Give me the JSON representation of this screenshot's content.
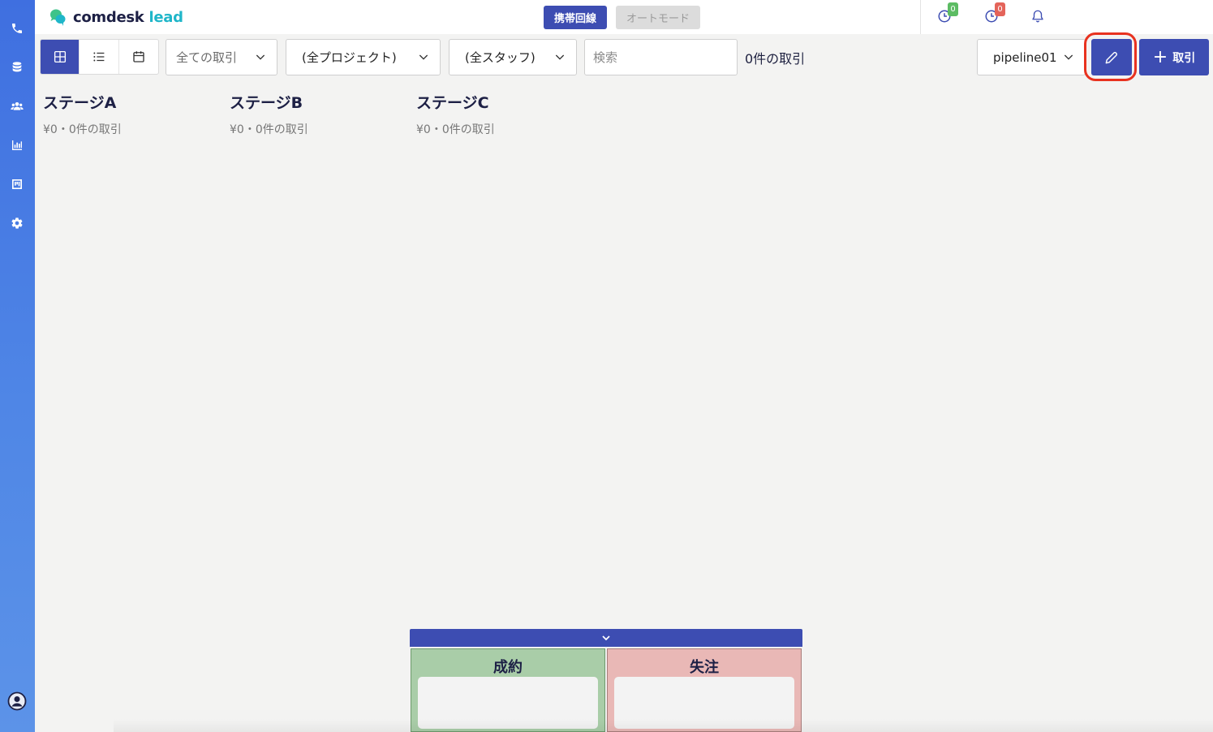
{
  "sidebar": {
    "items": [
      {
        "icon": "phone-icon"
      },
      {
        "icon": "database-icon"
      },
      {
        "icon": "users-icon"
      },
      {
        "icon": "bar-chart-icon"
      },
      {
        "icon": "kanban-icon"
      },
      {
        "icon": "gear-icon"
      }
    ],
    "bottom_icon": "user-circle-icon"
  },
  "header": {
    "logo_comdesk": "comdesk",
    "logo_lead": "lead",
    "mode_line_label": "携帯回線",
    "mode_auto_label": "オートモード",
    "clock1_badge": "0",
    "clock2_badge": "0"
  },
  "toolbar": {
    "deals_filter": "全ての取引",
    "project_filter": "(全プロジェクト)",
    "staff_filter": "(全スタッフ)",
    "search_placeholder": "検索",
    "deal_count": "0件の取引",
    "pipeline": "pipeline01",
    "add_label": "取引"
  },
  "stages": [
    {
      "name": "ステージA",
      "meta": "¥0・0件の取引"
    },
    {
      "name": "ステージB",
      "meta": "¥0・0件の取引"
    },
    {
      "name": "ステージC",
      "meta": "¥0・0件の取引"
    }
  ],
  "dropzones": {
    "won_label": "成約",
    "lost_label": "失注"
  },
  "colors": {
    "accent": "#3d4db2",
    "sidebar_top": "#3f6fe0",
    "won_bg": "#a9cda8",
    "lost_bg": "#e9b8b6",
    "highlight": "#e8321f"
  }
}
